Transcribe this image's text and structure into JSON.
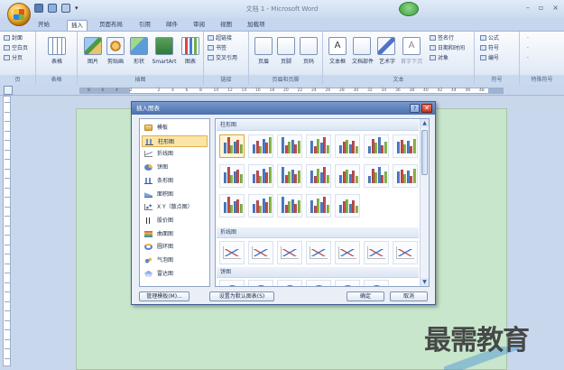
{
  "app": {
    "title": "文档 1 - Microsoft Word",
    "window_controls": [
      "–",
      "▫",
      "×"
    ]
  },
  "tabs": [
    "开始",
    "插入",
    "页面布局",
    "引用",
    "邮件",
    "审阅",
    "视图",
    "加载项"
  ],
  "active_tab": "插入",
  "ribbon": {
    "pages": {
      "items": [
        "封面",
        "空白页",
        "分页"
      ],
      "group": "页"
    },
    "tables": {
      "label": "表格",
      "group": "表格"
    },
    "illustrations": {
      "items": [
        "图片",
        "剪贴画",
        "形状",
        "SmartArt",
        "图表"
      ],
      "group": "插图"
    },
    "links": {
      "items": [
        "超链接",
        "书签",
        "交叉引用"
      ],
      "group": "链接"
    },
    "header_footer": {
      "items": [
        "页眉",
        "页脚",
        "页码"
      ],
      "group": "页眉和页脚"
    },
    "text": {
      "items": [
        "文本框",
        "文档部件",
        "艺术字",
        "首字下沉",
        "签名行",
        "日期和时间",
        "对象"
      ],
      "group": "文本"
    },
    "symbols": {
      "items": [
        "公式",
        "符号",
        "编号"
      ],
      "group": "符号"
    },
    "special": {
      "items": [
        "·",
        "·",
        "·"
      ],
      "group": "特殊符号"
    }
  },
  "ruler": {
    "ticks": [
      "8",
      "6",
      "4",
      "2",
      "",
      "2",
      "4",
      "6",
      "8",
      "10",
      "12",
      "14",
      "16",
      "18",
      "20",
      "22",
      "24",
      "26",
      "28",
      "30",
      "32",
      "34",
      "36",
      "38",
      "40",
      "42",
      "44",
      "46",
      "48"
    ]
  },
  "dialog": {
    "title": "插入图表",
    "help": "?",
    "close": "✕",
    "types": [
      {
        "label": "模板",
        "icon": "folder-icon"
      },
      {
        "label": "柱形图",
        "icon": "column-chart-icon"
      },
      {
        "label": "折线图",
        "icon": "line-chart-icon"
      },
      {
        "label": "饼图",
        "icon": "pie-chart-icon"
      },
      {
        "label": "条形图",
        "icon": "bar-chart-icon"
      },
      {
        "label": "面积图",
        "icon": "area-chart-icon"
      },
      {
        "label": "X Y（散点图）",
        "icon": "scatter-chart-icon"
      },
      {
        "label": "股价图",
        "icon": "stock-chart-icon"
      },
      {
        "label": "曲面图",
        "icon": "surface-chart-icon"
      },
      {
        "label": "圆环图",
        "icon": "doughnut-chart-icon"
      },
      {
        "label": "气泡图",
        "icon": "bubble-chart-icon"
      },
      {
        "label": "雷达图",
        "icon": "radar-chart-icon"
      }
    ],
    "selected_type": "柱形图",
    "sections": [
      "柱形图",
      "折线图",
      "饼图"
    ],
    "buttons": {
      "manage": "管理模板(M)...",
      "set_default": "设置为默认图表(S)",
      "ok": "确定",
      "cancel": "取消"
    }
  },
  "watermark": "最需教育",
  "colors": {
    "accent": "#4a6fae",
    "ribbon": "#dfe8f5",
    "page": "#c8e6cc",
    "selection": "#fbe4a7"
  }
}
